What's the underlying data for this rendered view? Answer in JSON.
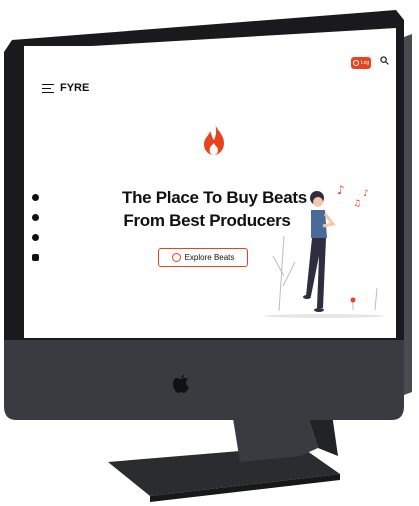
{
  "device": {
    "brand_icon": "apple-logo-icon"
  },
  "nav": {
    "brand": "FYRE",
    "menu_icon": "hamburger-icon",
    "login_label": "Log",
    "search_icon": "search-icon"
  },
  "hero": {
    "logo_icon": "flame-icon",
    "headline_line1": "The Place To Buy Beats",
    "headline_line2": "From Best Producers",
    "cta_label": "Explore Beats",
    "cta_icon": "play-circle-icon"
  },
  "socials": [
    {
      "icon": "twitter-icon"
    },
    {
      "icon": "messenger-icon"
    },
    {
      "icon": "facebook-icon"
    },
    {
      "icon": "instagram-icon"
    }
  ],
  "colors": {
    "accent": "#e8431f",
    "bezel": "#1a1a1e",
    "body": "#3a3b40"
  }
}
